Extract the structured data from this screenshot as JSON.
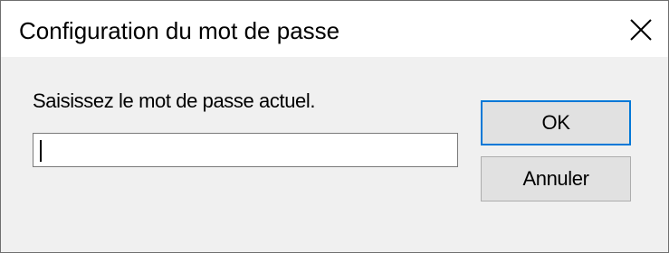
{
  "window": {
    "title": "Configuration du mot de passe",
    "close_icon": "close-icon"
  },
  "form": {
    "prompt": "Saisissez le mot de passe actuel.",
    "password_value": "",
    "password_placeholder": ""
  },
  "buttons": {
    "ok_label": "OK",
    "cancel_label": "Annuler"
  },
  "colors": {
    "focus_border": "#0078d7",
    "titlebar_bg": "#ffffff",
    "dialog_bg": "#f0f0f0",
    "button_bg": "#e1e1e1"
  }
}
